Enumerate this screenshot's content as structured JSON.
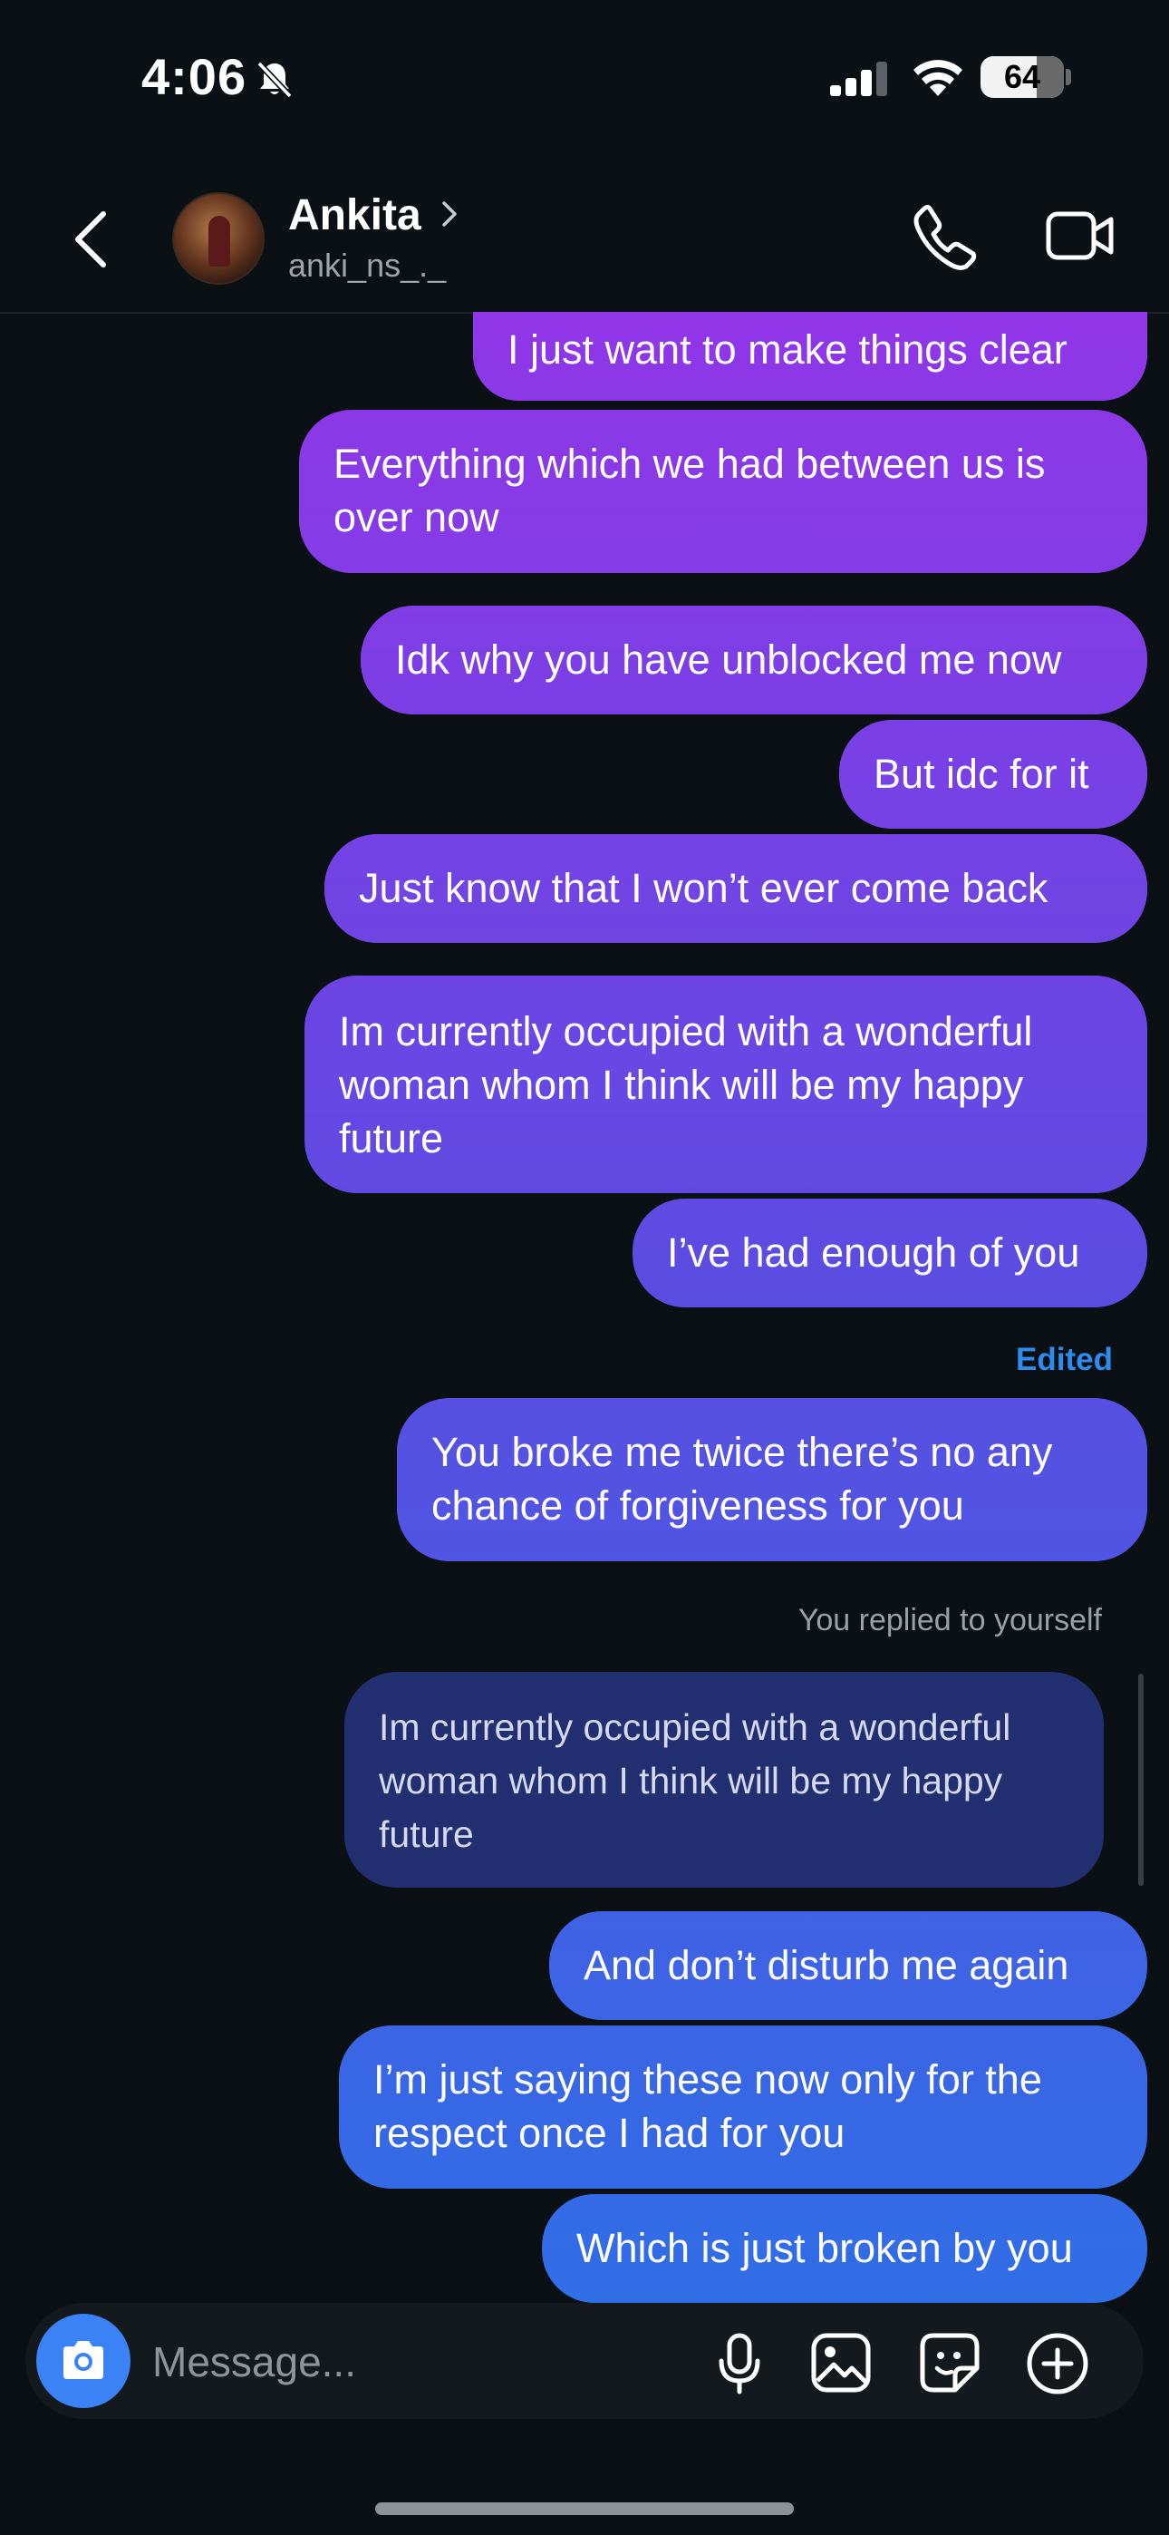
{
  "status_bar": {
    "time": "4:06",
    "battery": "64"
  },
  "header": {
    "name": "Ankita",
    "username": "anki_ns_._"
  },
  "thread": {
    "edited_label": "Edited",
    "reply_notice": "You replied to yourself",
    "messages": [
      {
        "lines": [
          "I just want to make things clear"
        ]
      },
      {
        "lines": [
          "Everything which we had between us is",
          "over now"
        ]
      },
      {
        "lines": [
          "Idk why you have unblocked me now"
        ]
      },
      {
        "lines": [
          "But idc for it"
        ]
      },
      {
        "lines": [
          "Just know that I won’t ever come back"
        ]
      },
      {
        "lines": [
          "Im currently occupied with a wonderful",
          "woman whom I think will be my happy",
          "future"
        ]
      },
      {
        "lines": [
          "I’ve had enough of you"
        ]
      },
      {
        "lines": [
          "You broke me twice there’s no any",
          "chance of forgiveness for you"
        ]
      },
      {
        "lines": [
          "Im currently occupied with a wonderful",
          "woman whom I think will be my happy",
          "future"
        ]
      },
      {
        "lines": [
          "And don’t disturb me again"
        ]
      },
      {
        "lines": [
          "I’m just saying these now only for the",
          "respect once I had for you"
        ]
      },
      {
        "lines": [
          "Which is just broken by you"
        ]
      }
    ]
  },
  "composer": {
    "placeholder": "Message..."
  },
  "colors": {
    "bubble_top": "#9136e8",
    "bubble_mid": "#5b4de2",
    "bubble_bottom": "#2f6ee6",
    "quoted_reply": "#222f70",
    "accent_blue": "#3b82f6"
  }
}
